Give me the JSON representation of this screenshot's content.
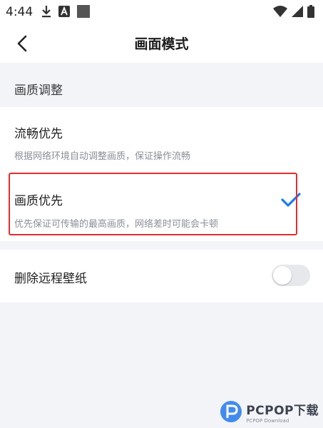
{
  "status_bar": {
    "time": "4:44",
    "left_icons": [
      "download-icon",
      "font-icon",
      "square-icon"
    ],
    "right_icons": [
      "wifi-icon",
      "signal-icon",
      "battery-icon"
    ]
  },
  "header": {
    "title": "画面模式",
    "back_icon": "chevron-left-icon"
  },
  "section": {
    "title": "画质调整"
  },
  "options": [
    {
      "label": "流畅优先",
      "description": "根据网络环境自动调整画质，保证操作流畅",
      "selected": false
    },
    {
      "label": "画质优先",
      "description": "优先保证可传输的最高画质，网络差时可能会卡顿",
      "selected": true
    }
  ],
  "remove_wallpaper": {
    "label": "删除远程壁纸",
    "enabled": false
  },
  "colors": {
    "accent": "#1a7cf5",
    "highlight": "#e32c2c",
    "background": "#f3f4f8"
  },
  "watermark": {
    "main": "PCPOP下载",
    "sub": "PCPOP Download"
  }
}
